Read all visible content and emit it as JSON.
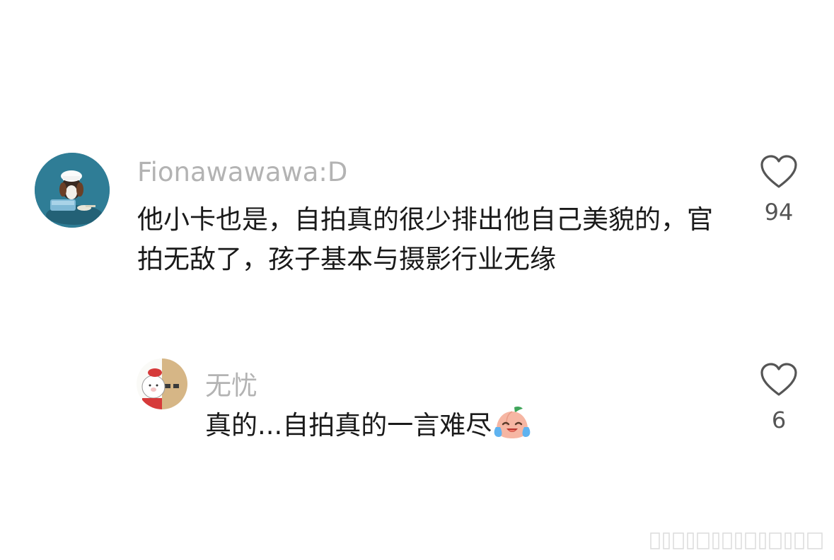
{
  "comments": [
    {
      "username": "Fionawawawa:D",
      "text": "他小卡也是，自拍真的很少排出他自己美貌的，官拍无敌了，孩子基本与摄影行业无缘",
      "likes": "94",
      "avatar": "dog-with-chef-hat-photo"
    },
    {
      "username": "无忧",
      "text": "真的...自拍真的一言难尽",
      "emoji": "crying-laughing-peach-emoji",
      "likes": "6",
      "avatar": "cartoon-pig-illustration"
    }
  ],
  "colors": {
    "username": "#b3b3b3",
    "text": "#1a1a1a",
    "like_count": "#555555",
    "background": "#ffffff"
  }
}
